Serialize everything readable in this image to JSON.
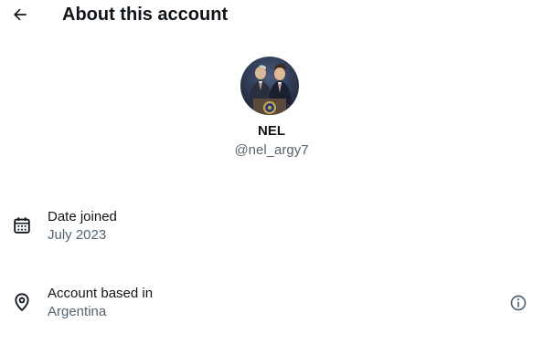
{
  "header": {
    "title": "About this account",
    "back_icon": "arrow-left-icon"
  },
  "profile": {
    "display_name": "NEL",
    "handle": "@nel_argy7"
  },
  "details": [
    {
      "icon": "calendar-icon",
      "label": "Date joined",
      "value": "July 2023"
    },
    {
      "icon": "location-pin-icon",
      "label": "Account based in",
      "value": "Argentina",
      "action_icon": "info-icon"
    }
  ]
}
